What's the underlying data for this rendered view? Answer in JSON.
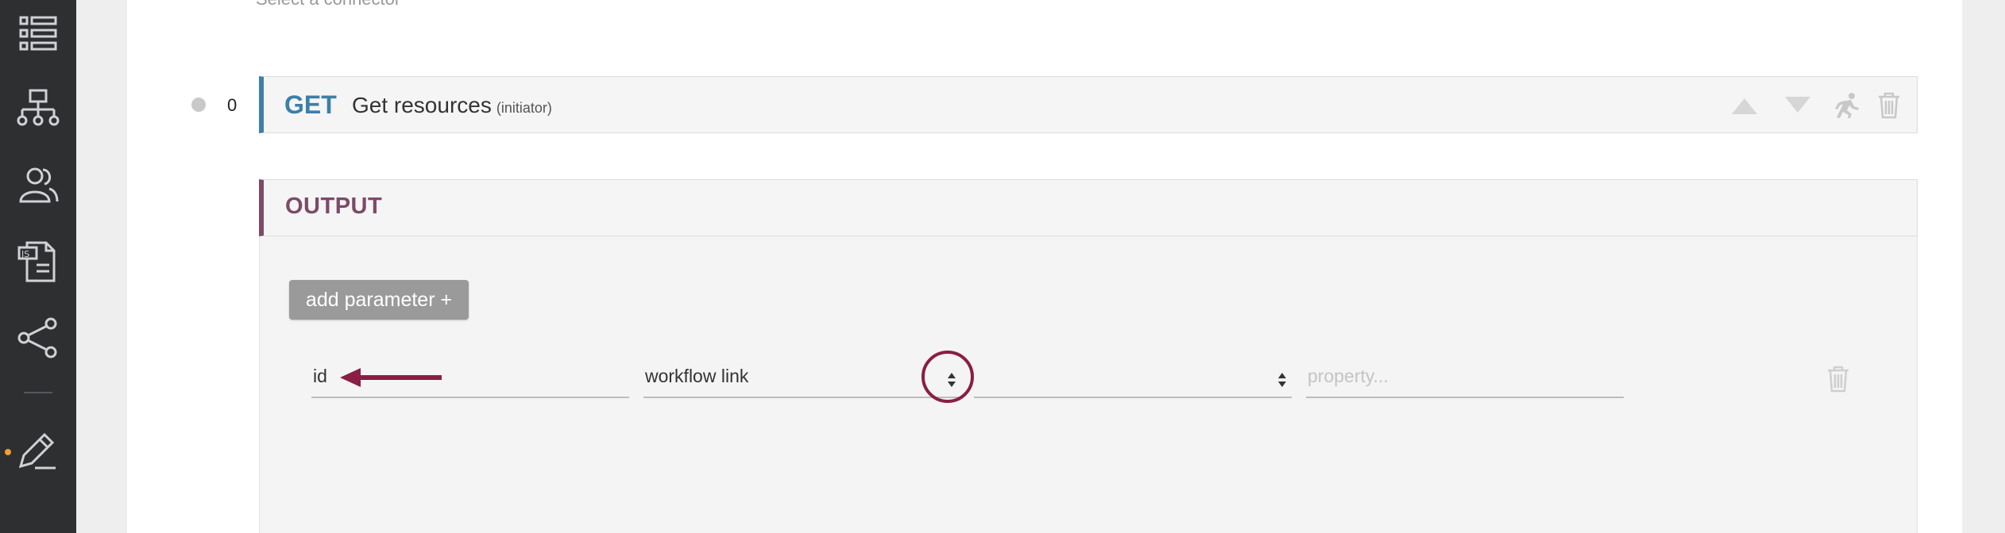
{
  "colors": {
    "sidebar_bg": "#2d2f31",
    "method_accent": "#3c7fa8",
    "output_accent": "#7d4a68",
    "annotation": "#8a1e44",
    "active_dot": "#f0a030"
  },
  "sidebar": {
    "items": [
      {
        "icon": "list-icon"
      },
      {
        "icon": "hierarchy-icon"
      },
      {
        "icon": "users-icon"
      },
      {
        "icon": "js-document-icon"
      },
      {
        "icon": "share-icon"
      },
      {
        "icon": "edit-icon",
        "active": true
      }
    ]
  },
  "main": {
    "subtitle": "Select a connector",
    "step": {
      "number": "0",
      "method": "GET",
      "title": "Get resources",
      "tag": "(initiator)",
      "toolbar": [
        "move-up-icon",
        "move-down-icon",
        "run-icon",
        "trash-icon"
      ]
    },
    "output": {
      "label": "OUTPUT",
      "add_parameter_label": "add parameter +",
      "row": {
        "name_value": "id",
        "type_value": "workflow link",
        "sub_value": "",
        "property_placeholder": "property..."
      }
    }
  }
}
